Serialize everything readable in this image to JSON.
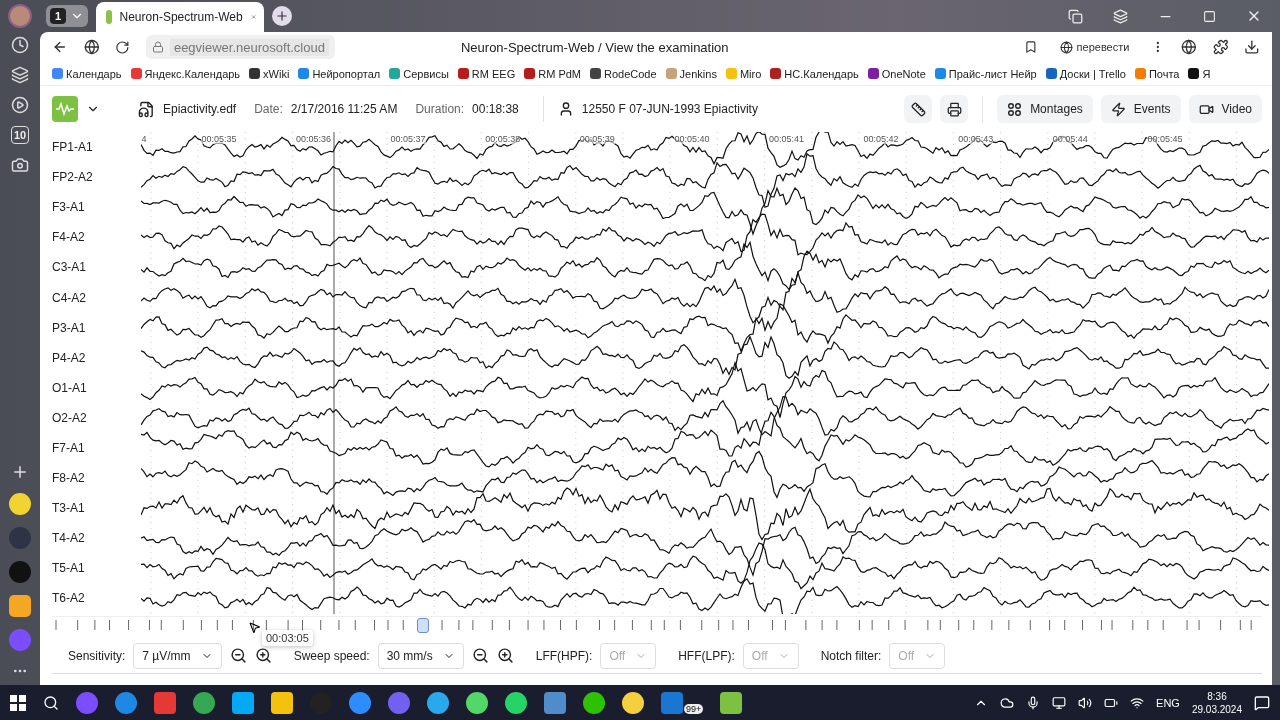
{
  "browser": {
    "tab_count": "1",
    "tab_title": "Neuron-Spectrum-Web",
    "url": "eegviewer.neurosoft.cloud",
    "page_title": "Neuron-Spectrum-Web / View the examination",
    "translate": "перевести",
    "bookmarks": [
      "Календарь",
      "Яндекс.Календарь",
      "xWiki",
      "Нейропортал",
      "Сервисы",
      "RM EEG",
      "RM PdM",
      "RodeCode",
      "Jenkins",
      "Miro",
      "НС.Календарь",
      "OneNote",
      "Прайс-лист Нейр",
      "Доски | Trello",
      "Почта",
      "Я"
    ]
  },
  "sidebar": {
    "badge": "10"
  },
  "header": {
    "file": "Epiactivity.edf",
    "date_label": "Date:",
    "date": "2/17/2016 11:25 AM",
    "duration_label": "Duration:",
    "duration": "00:18:38",
    "patient": "12550 F 07-JUN-1993 Epiactivity",
    "buttons": [
      "Montages",
      "Events",
      "Video"
    ]
  },
  "time_axis": [
    "4",
    "00:05:35",
    "00:05:36",
    "00:05:37",
    "00:05:38",
    "00:05:39",
    "00:05:40",
    "00:05:41",
    "00:05:42",
    "00:05:43",
    "00:05:44",
    "00:05:45"
  ],
  "channels": [
    "FP1-A1",
    "FP2-A2",
    "F3-A1",
    "F4-A2",
    "C3-A1",
    "C4-A2",
    "P3-A1",
    "P4-A2",
    "O1-A1",
    "O2-A2",
    "F7-A1",
    "F8-A2",
    "T3-A1",
    "T4-A2",
    "T5-A1",
    "T6-A2"
  ],
  "timeline": {
    "tooltip": "00:03:05",
    "level": 0.3
  },
  "controls": [
    {
      "kind": "zoomable",
      "label": "Sensitivity:",
      "value": "7 µV/mm",
      "disabled": false
    },
    {
      "kind": "zoomable",
      "label": "Sweep speed:",
      "value": "30 mm/s",
      "disabled": false
    },
    {
      "kind": "filter",
      "label": "LFF(HPF):",
      "value": "Off",
      "disabled": true
    },
    {
      "kind": "filter",
      "label": "HFF(LPF):",
      "value": "Off",
      "disabled": true
    },
    {
      "kind": "filter",
      "label": "Notch filter:",
      "value": "Off",
      "disabled": true
    }
  ],
  "taskbar": {
    "badge": "99+",
    "language": "ENG",
    "time": "8:36",
    "date": "29.03.2024"
  }
}
